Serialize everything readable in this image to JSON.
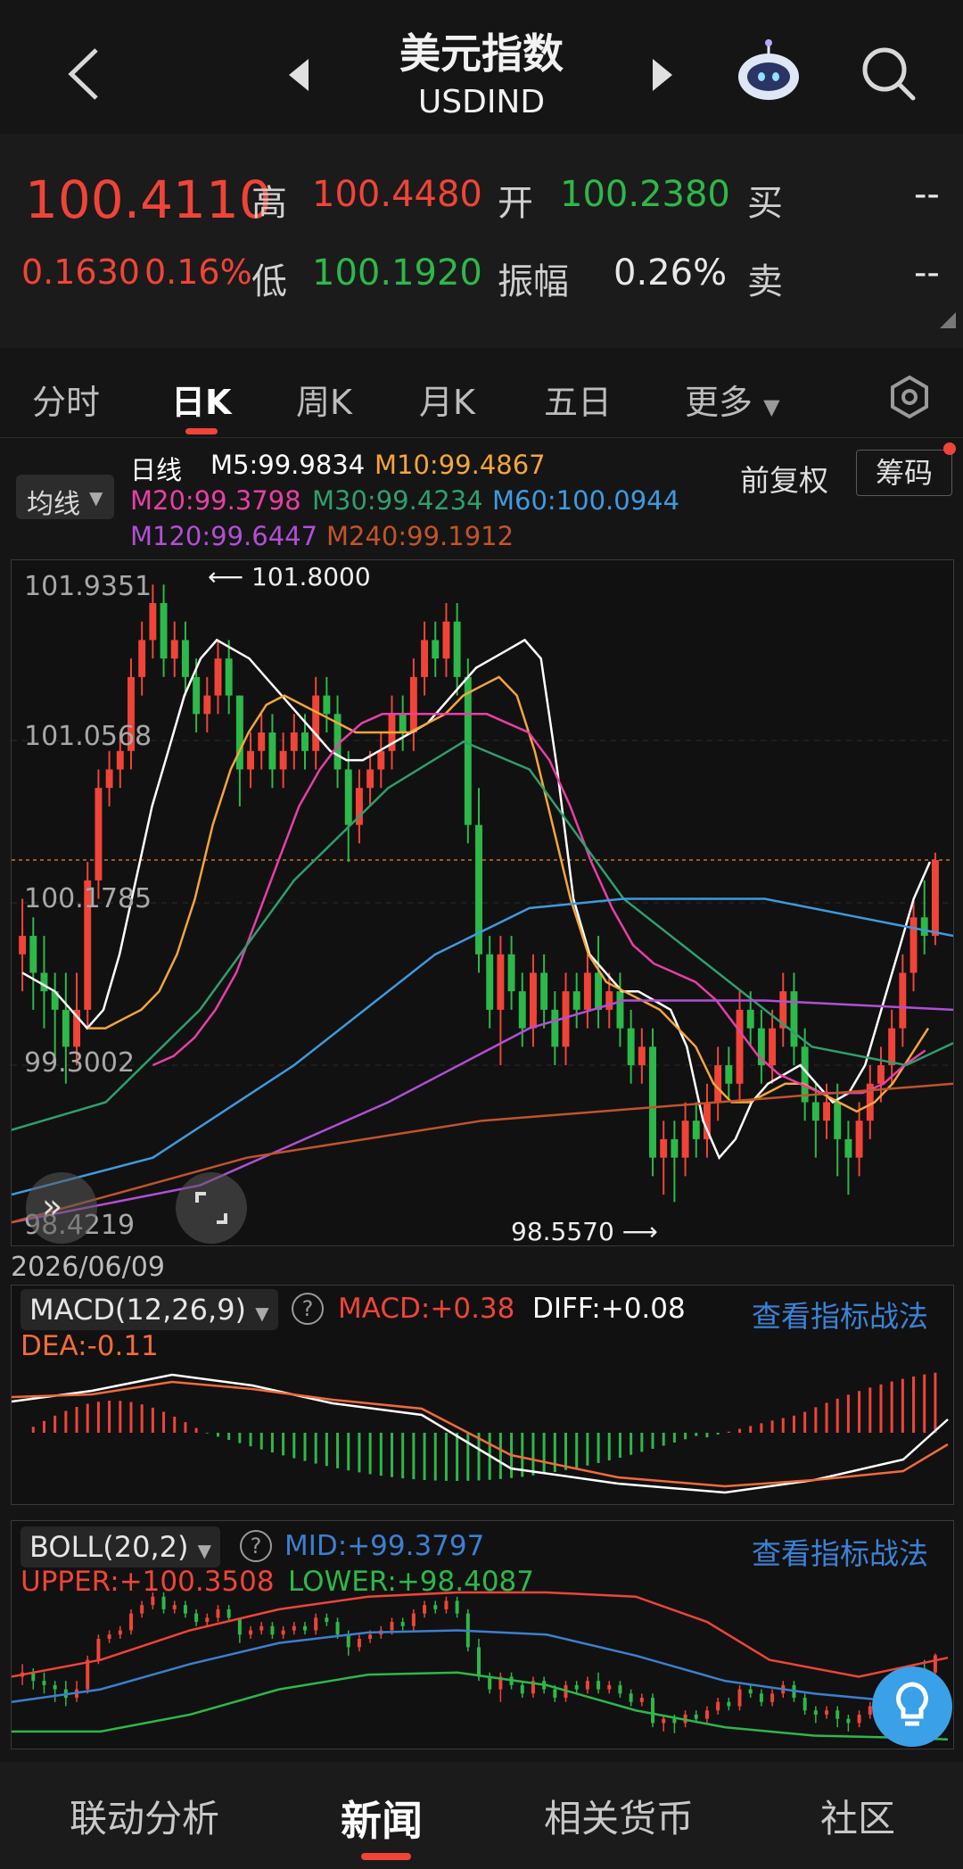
{
  "header": {
    "title": "美元指数",
    "subtitle": "USDIND"
  },
  "quote": {
    "price": "100.4110",
    "change": "0.1630",
    "change_pct": "0.16%",
    "high_label": "高",
    "high": "100.4480",
    "low_label": "低",
    "low": "100.1920",
    "open_label": "开",
    "open": "100.2380",
    "amp_label": "振幅",
    "amp": "0.26%",
    "buy_label": "买",
    "buy": "--",
    "sell_label": "卖",
    "sell": "--"
  },
  "tabs": [
    "分时",
    "日K",
    "周K",
    "月K",
    "五日",
    "更多"
  ],
  "legend": {
    "toggle": "均线",
    "period": "日线",
    "ma5": "M5:99.9834",
    "ma10": "M10:99.4867",
    "ma20": "M20:99.3798",
    "ma30": "M30:99.4234",
    "ma60": "M60:100.0944",
    "ma120": "M120:99.6447",
    "ma240": "M240:99.1912",
    "adjust": "前复权",
    "chips": "筹码"
  },
  "main_chart": {
    "y_labels": [
      "101.9351",
      "101.0568",
      "100.1785",
      "99.3002",
      "98.4219"
    ],
    "high_mark": "101.8000",
    "low_mark": "98.5570",
    "date": "2026/06/09"
  },
  "macd": {
    "dropdown": "MACD(12,26,9)",
    "macd": "MACD:+0.38",
    "diff": "DIFF:+0.08",
    "dea": "DEA:-0.11",
    "link": "查看指标战法"
  },
  "boll": {
    "dropdown": "BOLL(20,2)",
    "mid": "MID:+99.3797",
    "upper": "UPPER:+100.3508",
    "lower": "LOWER:+98.4087",
    "link": "查看指标战法"
  },
  "bottom_nav": [
    "联动分析",
    "新闻",
    "相关货币",
    "社区"
  ],
  "colors": {
    "up": "#f04438",
    "down": "#2db84a",
    "m5": "#ffffff",
    "m10": "#f3a63a",
    "m20": "#e83fa5",
    "m30": "#2e9f6e",
    "m60": "#3d9be0",
    "m120": "#b14fd6",
    "m240": "#c2542a"
  },
  "chart_data": {
    "type": "candlestick",
    "ylim": [
      98.4219,
      101.9351
    ],
    "candles": [
      [
        99.9,
        100.0,
        99.7,
        100.2
      ],
      [
        100.0,
        99.8,
        99.6,
        100.1
      ],
      [
        99.8,
        99.7,
        99.5,
        100.0
      ],
      [
        99.7,
        99.6,
        99.3,
        99.8
      ],
      [
        99.6,
        99.4,
        99.2,
        99.8
      ],
      [
        99.4,
        99.6,
        99.3,
        99.8
      ],
      [
        99.6,
        100.3,
        99.5,
        100.4
      ],
      [
        100.3,
        100.8,
        100.2,
        100.9
      ],
      [
        100.8,
        100.9,
        100.7,
        101.0
      ],
      [
        100.9,
        101.0,
        100.8,
        101.1
      ],
      [
        101.0,
        101.4,
        100.9,
        101.5
      ],
      [
        101.4,
        101.6,
        101.3,
        101.7
      ],
      [
        101.6,
        101.8,
        101.5,
        101.9
      ],
      [
        101.8,
        101.5,
        101.4,
        101.9
      ],
      [
        101.5,
        101.6,
        101.4,
        101.7
      ],
      [
        101.6,
        101.4,
        101.3,
        101.7
      ],
      [
        101.4,
        101.2,
        101.1,
        101.5
      ],
      [
        101.2,
        101.3,
        101.1,
        101.4
      ],
      [
        101.3,
        101.5,
        101.2,
        101.6
      ],
      [
        101.5,
        101.3,
        101.2,
        101.6
      ],
      [
        101.3,
        100.9,
        100.7,
        101.3
      ],
      [
        100.9,
        101.0,
        100.8,
        101.1
      ],
      [
        101.0,
        101.1,
        100.9,
        101.2
      ],
      [
        101.1,
        100.9,
        100.8,
        101.2
      ],
      [
        100.9,
        101.0,
        100.8,
        101.1
      ],
      [
        101.0,
        101.1,
        100.9,
        101.2
      ],
      [
        101.1,
        101.0,
        100.9,
        101.2
      ],
      [
        101.0,
        101.3,
        100.9,
        101.4
      ],
      [
        101.3,
        101.2,
        101.1,
        101.4
      ],
      [
        101.2,
        100.9,
        100.8,
        101.3
      ],
      [
        100.9,
        100.6,
        100.4,
        101.0
      ],
      [
        100.6,
        100.8,
        100.5,
        100.9
      ],
      [
        100.8,
        100.9,
        100.7,
        101.0
      ],
      [
        100.9,
        101.0,
        100.8,
        101.1
      ],
      [
        101.0,
        101.2,
        100.9,
        101.3
      ],
      [
        101.2,
        101.1,
        101.0,
        101.3
      ],
      [
        101.1,
        101.4,
        101.0,
        101.5
      ],
      [
        101.4,
        101.6,
        101.3,
        101.7
      ],
      [
        101.6,
        101.5,
        101.4,
        101.7
      ],
      [
        101.5,
        101.7,
        101.4,
        101.8
      ],
      [
        101.7,
        101.4,
        101.3,
        101.8
      ],
      [
        101.4,
        100.6,
        100.5,
        101.5
      ],
      [
        100.6,
        99.9,
        99.8,
        100.8
      ],
      [
        99.9,
        99.6,
        99.5,
        100.0
      ],
      [
        99.6,
        99.9,
        99.3,
        100.0
      ],
      [
        99.9,
        99.7,
        99.6,
        100.0
      ],
      [
        99.7,
        99.5,
        99.4,
        99.8
      ],
      [
        99.5,
        99.8,
        99.4,
        99.9
      ],
      [
        99.8,
        99.6,
        99.5,
        99.9
      ],
      [
        99.6,
        99.4,
        99.3,
        99.7
      ],
      [
        99.4,
        99.7,
        99.3,
        99.8
      ],
      [
        99.7,
        99.6,
        99.5,
        99.8
      ],
      [
        99.6,
        99.8,
        99.5,
        99.9
      ],
      [
        99.8,
        99.6,
        99.5,
        100.0
      ],
      [
        99.6,
        99.7,
        99.5,
        99.8
      ],
      [
        99.7,
        99.5,
        99.4,
        99.8
      ],
      [
        99.5,
        99.3,
        99.2,
        99.6
      ],
      [
        99.3,
        99.4,
        99.2,
        99.5
      ],
      [
        99.4,
        98.8,
        98.7,
        99.5
      ],
      [
        98.8,
        98.9,
        98.6,
        99.0
      ],
      [
        98.9,
        98.8,
        98.56,
        99.0
      ],
      [
        98.8,
        99.0,
        98.7,
        99.1
      ],
      [
        99.0,
        98.9,
        98.8,
        99.1
      ],
      [
        98.9,
        99.1,
        98.8,
        99.2
      ],
      [
        99.1,
        99.3,
        99.0,
        99.4
      ],
      [
        99.3,
        99.2,
        99.1,
        99.4
      ],
      [
        99.2,
        99.6,
        99.1,
        99.7
      ],
      [
        99.6,
        99.5,
        99.4,
        99.7
      ],
      [
        99.5,
        99.3,
        99.2,
        99.6
      ],
      [
        99.3,
        99.5,
        99.2,
        99.6
      ],
      [
        99.5,
        99.7,
        99.4,
        99.8
      ],
      [
        99.7,
        99.4,
        99.3,
        99.8
      ],
      [
        99.4,
        99.1,
        99.0,
        99.5
      ],
      [
        99.1,
        99.0,
        98.8,
        99.2
      ],
      [
        99.0,
        99.1,
        98.9,
        99.2
      ],
      [
        99.1,
        98.9,
        98.7,
        99.2
      ],
      [
        98.9,
        98.8,
        98.6,
        99.0
      ],
      [
        98.8,
        99.0,
        98.7,
        99.1
      ],
      [
        99.0,
        99.2,
        98.9,
        99.3
      ],
      [
        99.2,
        99.3,
        99.1,
        99.4
      ],
      [
        99.3,
        99.5,
        99.2,
        99.6
      ],
      [
        99.5,
        99.8,
        99.4,
        99.9
      ],
      [
        99.8,
        100.1,
        99.7,
        100.2
      ],
      [
        100.1,
        100.0,
        99.9,
        100.3
      ],
      [
        100.0,
        100.41,
        99.95,
        100.45
      ]
    ],
    "ma": {
      "m5": [
        99.8,
        99.75,
        99.7,
        99.6,
        99.5,
        99.6,
        99.9,
        100.3,
        100.7,
        101.0,
        101.3,
        101.5,
        101.6,
        101.55,
        101.5,
        101.4,
        101.3,
        101.2,
        101.1,
        101.0,
        100.95,
        100.95,
        101.0,
        101.05,
        101.1,
        101.15,
        101.25,
        101.35,
        101.45,
        101.5,
        101.55,
        101.6,
        101.5,
        100.9,
        100.2,
        99.9,
        99.8,
        99.7,
        99.7,
        99.65,
        99.6,
        99.4,
        99.0,
        98.8,
        98.9,
        99.1,
        99.2,
        99.25,
        99.3,
        99.2,
        99.1,
        99.15,
        99.3,
        99.6,
        99.9,
        100.2,
        100.4
      ],
      "m10": [
        99.5,
        99.5,
        99.55,
        99.6,
        99.7,
        99.9,
        100.2,
        100.6,
        100.9,
        101.1,
        101.25,
        101.3,
        101.25,
        101.2,
        101.15,
        101.1,
        101.1,
        101.1,
        101.1,
        101.15,
        101.2,
        101.3,
        101.35,
        101.4,
        101.3,
        101.0,
        100.6,
        100.2,
        99.9,
        99.75,
        99.7,
        99.65,
        99.6,
        99.5,
        99.4,
        99.2,
        99.1,
        99.1,
        99.15,
        99.2,
        99.2,
        99.15,
        99.1,
        99.05,
        99.1,
        99.2,
        99.35,
        99.5
      ],
      "m20": [
        99.3,
        99.35,
        99.45,
        99.6,
        99.8,
        100.1,
        100.4,
        100.7,
        100.9,
        101.05,
        101.15,
        101.2,
        101.2,
        101.2,
        101.2,
        101.2,
        101.2,
        101.15,
        101.1,
        100.95,
        100.7,
        100.4,
        100.15,
        99.95,
        99.85,
        99.8,
        99.75,
        99.65,
        99.5,
        99.35,
        99.25,
        99.2,
        99.15,
        99.15,
        99.15,
        99.2,
        99.3,
        99.38
      ]
    }
  }
}
